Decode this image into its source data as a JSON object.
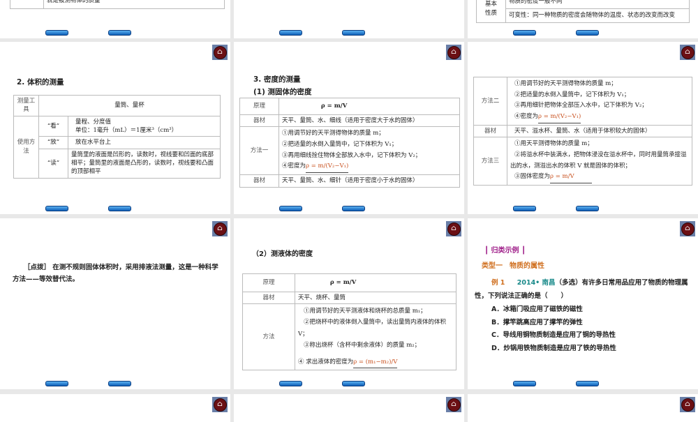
{
  "slides": {
    "s1": {
      "partial_text": "就是被测物体的质量"
    },
    "s3": {
      "row_label_a": "基本",
      "row_label_b": "性质",
      "cell1": "物质的密度一般不同",
      "cell2": "可变性：同一种物质的密度会随物体的温度、状态的改变而改变"
    },
    "s4": {
      "title": "2. 体积的测量",
      "tool_label": "测量工具",
      "tool_value": "量筒、量杯",
      "use_label": "使用方法",
      "rows": [
        {
          "k": "“看”",
          "v1": "量程、分度值",
          "v2": "单位：1毫升（mL）＝1厘米³（cm³）"
        },
        {
          "k": "“放”",
          "v1": "放在水平台上"
        },
        {
          "k": "“读”",
          "v1": "量筒里的液面是凹形的，读数时，视线要和凹面的底部相平；量筒里的液面是凸形的，读数时，视线要和凸面的顶部相平"
        }
      ]
    },
    "s5": {
      "title": "3. 密度的测量",
      "subtitle": "(1) 测固体的密度",
      "principle_label": "原理",
      "principle": "ρ = m/V",
      "equip_label": "器材",
      "equip1": "天平、量筒、水、细线（适用于密度大于水的固体）",
      "method_label": "方法一",
      "steps": [
        "①用调节好的天平测得物体的质量 m；",
        "②把适量的水倒入量筒中，记下体积为 V₁；",
        "③再用细线拴住物体全部放入水中，记下体积为 V₂；",
        "④密度为"
      ],
      "answer": "ρ = m/(V₂−V₁)",
      "equip2": "天平、量筒、水、细针（适用于密度小于水的固体）"
    },
    "s6": {
      "method_label": "方法二",
      "steps": [
        "①用调节好的天平测得物体的质量 m；",
        "②把适量的水倒入量筒中，记下体积为 V₁；",
        "③再用细针把物体全部压入水中，记下体积为 V₂；",
        "④密度为"
      ],
      "answer": "ρ = m/(V₂−V₁)",
      "equip_label": "器材",
      "equip": "天平、溢水杯、量筒、水（适用于体积较大的固体）",
      "method3_label": "方法三",
      "steps3": [
        "①用天平测得物体的质量 m；",
        "②将溢水杯中装满水，把物体浸没在溢水杯中，同时用量筒承接溢出的水，测溢出水的体积 V 就是固体的体积；",
        "③固体密度为"
      ],
      "answer3": "ρ = m/V"
    },
    "s7": {
      "text": "［点拨］ 在测不规则固体体积时，采用排液法测量，这是一种科学方法——等效替代法。"
    },
    "s8": {
      "title": "（2）测液体的密度",
      "principle_label": "原理",
      "principle": "ρ = m/V",
      "equip_label": "器材",
      "equip": "天平、烧杯、量筒",
      "method_label": "方法",
      "steps": [
        "①用调节好的天平测液体和烧杯的总质量 m₁；",
        "②把烧杯中的液体倒入量筒中，读出量筒内液体的体积 V；",
        "③称出烧杯（含杯中剩余液体）的质量 m₂；",
        "④ 求出液体的密度为"
      ],
      "answer": "ρ = (m₁−m₂)/V"
    },
    "s9": {
      "section": "┃ 归类示例 ┃",
      "type": "类型一　物质的属性",
      "ex_label": "例 1",
      "ex_src": "2014• 南昌",
      "ex_text": "（多选）有许多日常用品应用了物质的物理属性，下列说法正确的是（　　）",
      "options": [
        "A．冰箱门吸应用了磁铁的磁性",
        "B．撑竿跳高应用了撑竿的弹性",
        "C．导线用铜物质制造是应用了铜的导热性",
        "D．炒锅用铁物质制造是应用了铁的导热性"
      ]
    }
  },
  "colors": {
    "accent": "#c8501e",
    "section": "#a0208a",
    "home": "#6b0f14",
    "nav": "#1068c0"
  }
}
